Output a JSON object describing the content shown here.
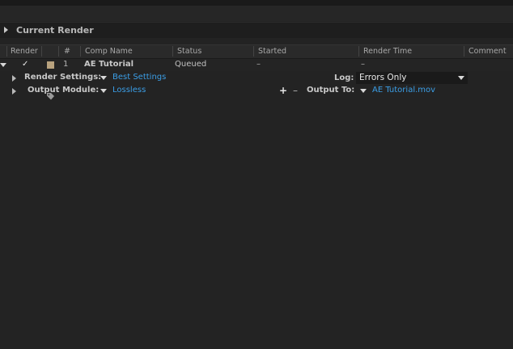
{
  "panel": {
    "title": "Current Render"
  },
  "columns": {
    "render": "Render",
    "number": "#",
    "comp_name": "Comp Name",
    "status": "Status",
    "started": "Started",
    "render_time": "Render Time",
    "comment": "Comment"
  },
  "item": {
    "checked": "✓",
    "label_color": "#b8a27e",
    "number": "1",
    "comp_name": "AE Tutorial",
    "status": "Queued",
    "started": "–",
    "render_time": "–"
  },
  "render_settings": {
    "label": "Render Settings:",
    "value": "Best Settings",
    "log_label": "Log:",
    "log_value": "Errors Only"
  },
  "output_module": {
    "label": "Output Module:",
    "value": "Lossless",
    "add": "+",
    "remove": "–",
    "output_to_label": "Output To:",
    "output_to_value": "AE Tutorial.mov"
  }
}
